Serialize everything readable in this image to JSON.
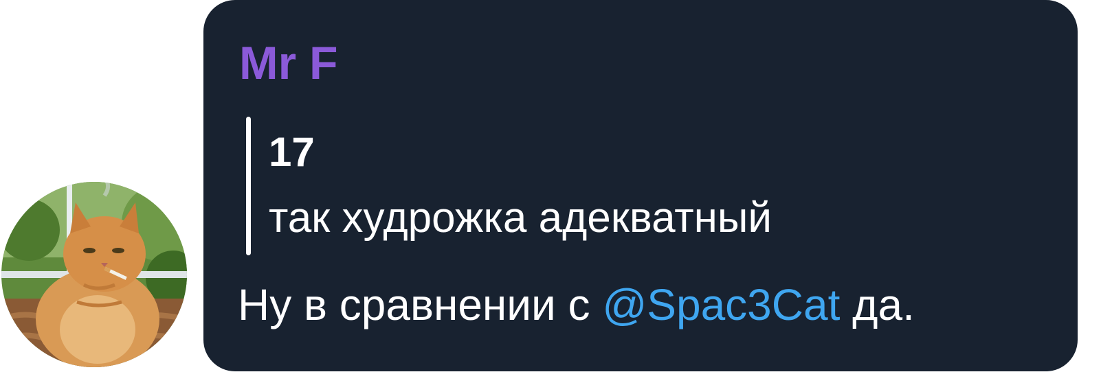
{
  "avatar": {
    "icon": "cat-photo-avatar"
  },
  "message": {
    "sender": "Mr F",
    "reply": {
      "author": "17",
      "text": "так худрожка адекватный"
    },
    "text_before": "Ну в сравнении с ",
    "mention": "@Spac3Cat",
    "text_after": " да."
  },
  "colors": {
    "bubble_bg": "#182230",
    "sender_name": "#8b5ad9",
    "mention": "#3fa6f0",
    "text": "#ffffff"
  }
}
